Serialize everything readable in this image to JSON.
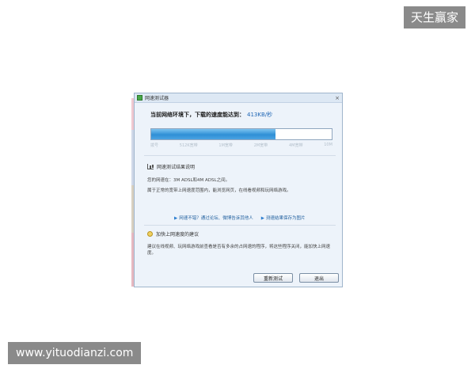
{
  "watermarks": {
    "top": "天生赢家",
    "bottom": "www.yituodianzi.com"
  },
  "dialog": {
    "title": "网速测试器",
    "close_glyph": "×",
    "speed_label": "当前网络环境下，下载的速度能达到：",
    "speed_value": "413KB/秒",
    "progress_fraction": 0.69,
    "scale_labels": [
      "拨号",
      "512K宽带",
      "1M宽带",
      "2M宽带",
      "4M宽带",
      "10M"
    ],
    "result_section": {
      "heading": "网速测试结果说明",
      "line1": "您的网速在：3M ADSL和4M ADSL之间。",
      "line2": "属于正常的宽带上网速度范围内，能浏览网页，在线看视频和玩网络游戏。"
    },
    "links": [
      "网速不错？通过论坛、微博告诉其他人",
      "测速结果保存为图片"
    ],
    "tips_section": {
      "heading": "加快上网速度的建议",
      "text": "建议在线视频、玩网络游戏前查看是否有多余的占网速的程序，将这些程序关闭，能加快上网速度。"
    },
    "buttons": {
      "retest": "重新测试",
      "exit": "退出"
    },
    "colors": {
      "accent": "#1f66b5",
      "bar_fill": "#2f8fd6",
      "link": "#1f5f9e"
    }
  }
}
